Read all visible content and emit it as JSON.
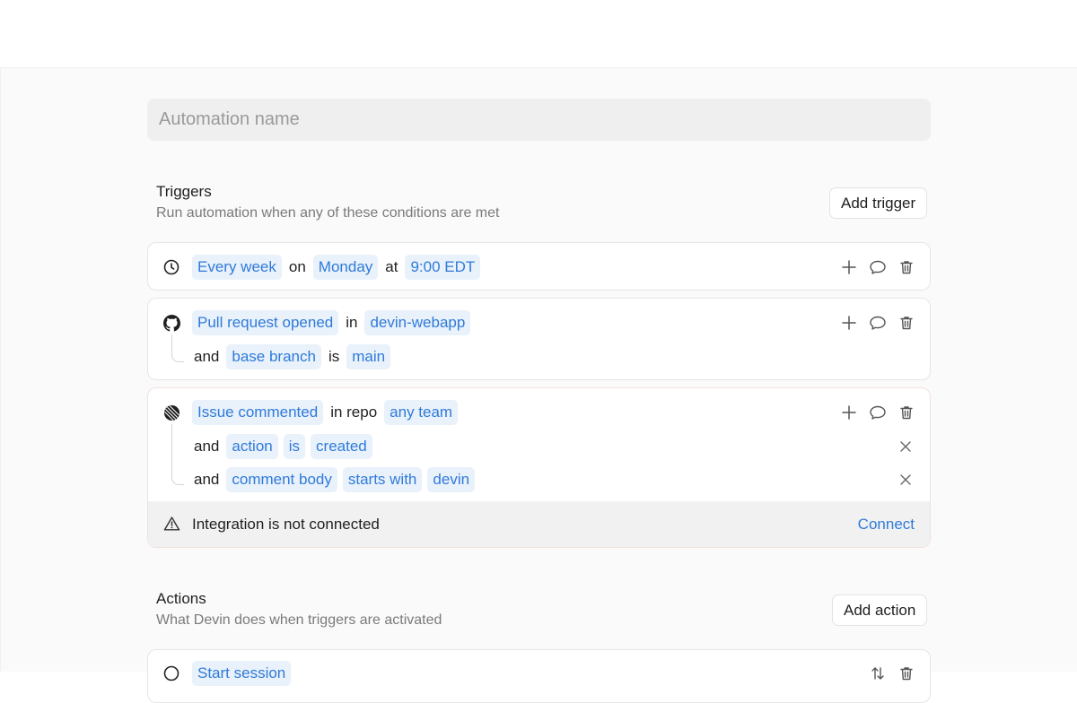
{
  "automation_name": {
    "placeholder": "Automation name",
    "value": ""
  },
  "triggers": {
    "title": "Triggers",
    "subtitle": "Run automation when any of these conditions are met",
    "add_label": "Add trigger",
    "schedule": {
      "icon": "clock-icon",
      "frequency": "Every week",
      "on_word": "on",
      "day": "Monday",
      "at_word": "at",
      "time": "9:00 EDT"
    },
    "github": {
      "icon": "github-icon",
      "event": "Pull request opened",
      "in_word": "in",
      "repo": "devin-webapp",
      "condition": {
        "and_word": "and",
        "field": "base branch",
        "op": "is",
        "value": "main"
      }
    },
    "linear": {
      "icon": "linear-icon",
      "event": "Issue commented",
      "in_word": "in repo",
      "team": "any team",
      "conditions": [
        {
          "and_word": "and",
          "field": "action",
          "op": "is",
          "value": "created"
        },
        {
          "and_word": "and",
          "field": "comment body",
          "op": "starts with",
          "value": "devin"
        }
      ],
      "warning": "Integration is not connected",
      "connect_label": "Connect"
    }
  },
  "actions": {
    "title": "Actions",
    "subtitle": "What Devin does when triggers are activated",
    "add_label": "Add action",
    "first_action": {
      "label": "Start session"
    }
  },
  "colors": {
    "accent": "#2f7bd9",
    "chip_bg": "#e9f1fb"
  }
}
